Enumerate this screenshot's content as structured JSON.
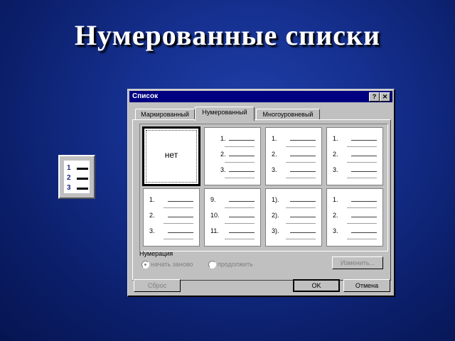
{
  "slide": {
    "title": "Нумерованные списки"
  },
  "toolbar_icon": {
    "icon": "numbering-icon",
    "numbers": [
      "1",
      "2",
      "3"
    ]
  },
  "dialog": {
    "title": "Список",
    "help_button": "?",
    "close_button": "✕",
    "tabs": [
      {
        "label": "Маркированный",
        "active": false
      },
      {
        "label": "Нумерованный",
        "active": true
      },
      {
        "label": "Многоуровневый",
        "active": false
      }
    ],
    "gallery": [
      {
        "kind": "none",
        "text": "нет",
        "selected": true
      },
      {
        "kind": "list",
        "items": [
          "1.",
          "2.",
          "3."
        ]
      },
      {
        "kind": "list",
        "items": [
          "1.",
          "2.",
          "3."
        ]
      },
      {
        "kind": "list",
        "items": [
          "1.",
          "2.",
          "3."
        ]
      },
      {
        "kind": "list",
        "items": [
          "1.",
          "2.",
          "3."
        ]
      },
      {
        "kind": "list",
        "items": [
          "9.",
          "10.",
          "11."
        ]
      },
      {
        "kind": "list",
        "items": [
          "1).",
          "2).",
          "3)."
        ]
      },
      {
        "kind": "list",
        "items": [
          "1.",
          "2.",
          "3."
        ]
      }
    ],
    "numbering_group": "Нумерация",
    "radio_restart": "начать заново",
    "radio_continue": "продолжить",
    "modify_button": "Изменить...",
    "reset_button": "Сброс",
    "ok_button": "OK",
    "cancel_button": "Отмена"
  }
}
